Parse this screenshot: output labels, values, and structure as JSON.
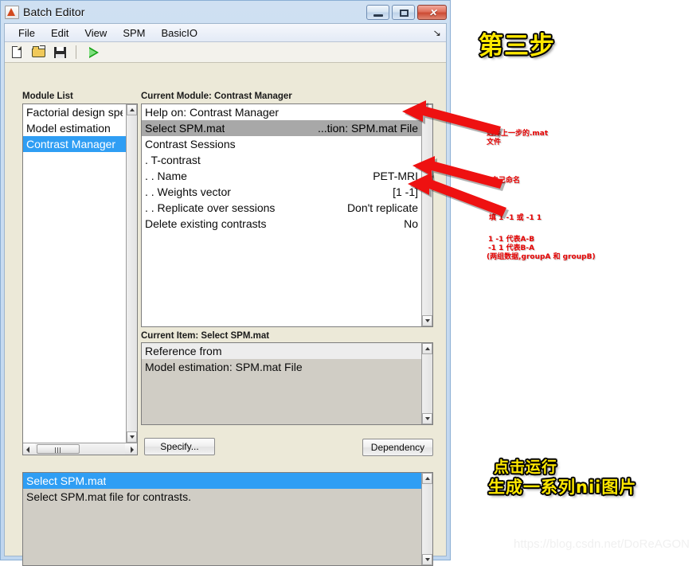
{
  "window": {
    "title": "Batch Editor",
    "icon": "matlab-icon",
    "controls": {
      "minimize": "minimize-button",
      "maximize": "maximize-button",
      "close_glyph": "✕"
    }
  },
  "menubar": {
    "items": [
      "File",
      "Edit",
      "View",
      "SPM",
      "BasicIO"
    ],
    "dock_arrow": "↘"
  },
  "toolbar": {
    "buttons": [
      {
        "name": "new-file-button",
        "icon": "new-file-icon"
      },
      {
        "name": "open-file-button",
        "icon": "open-folder-icon"
      },
      {
        "name": "save-file-button",
        "icon": "save-floppy-icon"
      },
      {
        "name": "run-button",
        "icon": "run-triangle-icon"
      }
    ]
  },
  "module_list": {
    "heading": "Module List",
    "items": [
      {
        "label": "Factorial design specification",
        "selected": false
      },
      {
        "label": "Model estimation",
        "selected": false
      },
      {
        "label": "Contrast Manager",
        "selected": true
      }
    ]
  },
  "current_module": {
    "heading": "Current Module: Contrast Manager",
    "rows": [
      {
        "label": "Help on: Contrast Manager",
        "value": "",
        "selected": false
      },
      {
        "label": "Select SPM.mat",
        "value": "...tion: SPM.mat File",
        "selected": true
      },
      {
        "label": "Contrast Sessions",
        "value": "",
        "selected": false
      },
      {
        "label": ". T-contrast",
        "value": "",
        "selected": false
      },
      {
        "label": ". . Name",
        "value": "PET-MRI",
        "selected": false
      },
      {
        "label": ". . Weights vector",
        "value": "[1 -1]",
        "selected": false
      },
      {
        "label": ". . Replicate over sessions",
        "value": "Don't replicate",
        "selected": false
      },
      {
        "label": "Delete existing contrasts",
        "value": "No",
        "selected": false
      }
    ]
  },
  "current_item": {
    "heading": "Current Item: Select SPM.mat",
    "rows": [
      {
        "label": "Reference from",
        "value": "",
        "selected": false
      },
      {
        "label": "Model estimation: SPM.mat File",
        "value": "",
        "selected": false
      }
    ],
    "specify_button": "Specify...",
    "dependency_button": "Dependency"
  },
  "help_panel": {
    "rows": [
      {
        "label": "Select SPM.mat",
        "value": "",
        "selected": true
      },
      {
        "label": "Select SPM.mat file for contrasts.",
        "value": "",
        "selected": false
      }
    ]
  },
  "annotations": {
    "step_title": "第三步",
    "note_select_mat": "选择上一步的.mat\n文件",
    "note_name": "自己命名",
    "note_weights_title": "填 1 -1 或 -1 1",
    "note_weights_l1": "1 -1 代表A-B",
    "note_weights_l2": "-1 1 代表B-A",
    "note_weights_l3": "(两组数据,groupA 和 groupB)",
    "run_note_l1": "点击运行",
    "run_note_l2": "生成一系列nii图片"
  },
  "watermark": "https://blog.csdn.net/DoReAGON",
  "colors": {
    "selection_blue": "#2f9ef4",
    "selection_gray": "#a8a8a8",
    "panel_beige": "#ece9d8",
    "list_gray": "#d0cdc5",
    "arrow_red": "#ee1111",
    "annot_yellow": "#ffe800",
    "annot_red": "#e60000",
    "close_button_red": "#cc4a33"
  }
}
